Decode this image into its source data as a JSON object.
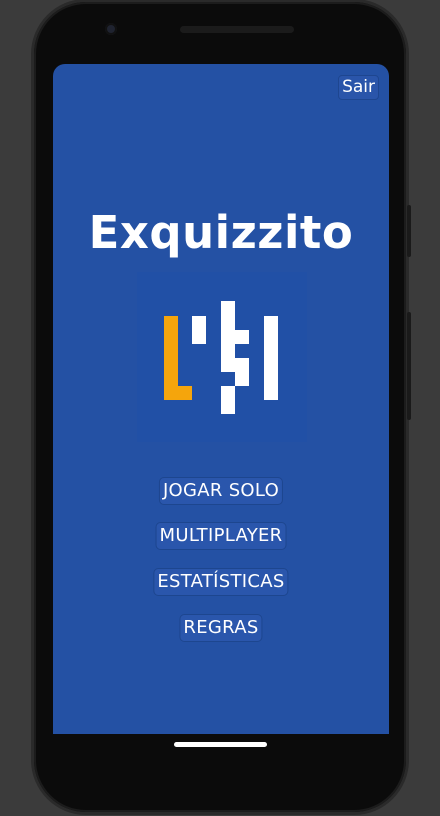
{
  "header": {
    "exit_label": "Sair"
  },
  "app": {
    "title": "Exquizzito"
  },
  "menu": {
    "items": [
      {
        "label": "JOGAR SOLO"
      },
      {
        "label": "MULTIPLAYER"
      },
      {
        "label": "ESTATÍSTICAS"
      },
      {
        "label": "REGRAS"
      }
    ]
  },
  "colors": {
    "background": "#2451a4",
    "accent": "#f5a50c",
    "text": "#ffffff"
  },
  "icons": {
    "logo": "pixel-blocks-logo-icon"
  }
}
